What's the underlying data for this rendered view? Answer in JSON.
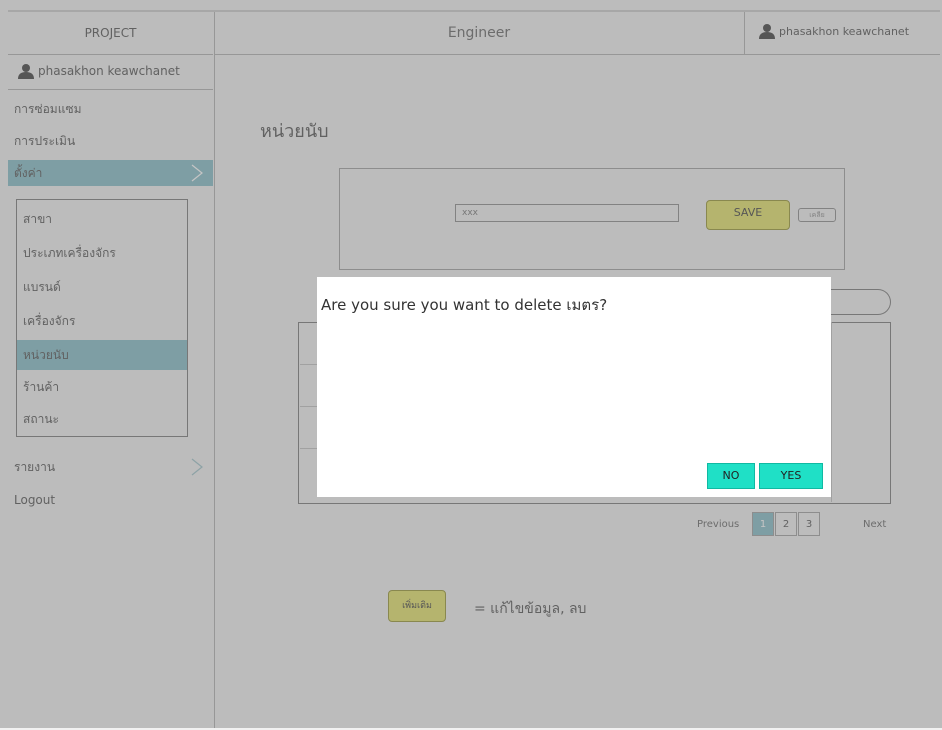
{
  "colors": {
    "accent": "#93c3cc",
    "button_yellow": "#e6e57a",
    "dialog_button": "#1fe0c6"
  },
  "sidebar": {
    "project_label": "PROJECT",
    "user_name": "phasakhon keawchanet",
    "menu": [
      {
        "label": "การซ่อมแซม"
      },
      {
        "label": "การประเมิน"
      },
      {
        "label": "ตั้งค่า"
      }
    ],
    "submenu": [
      {
        "label": "สาขา"
      },
      {
        "label": "ประเภทเครื่องจักร"
      },
      {
        "label": "แบรนด์"
      },
      {
        "label": "เครื่องจักร"
      },
      {
        "label": "หน่วยนับ"
      },
      {
        "label": "ร้านค้า"
      },
      {
        "label": "สถานะ"
      }
    ],
    "report_label": "รายงาน",
    "logout_label": "Logout"
  },
  "header": {
    "title": "Engineer",
    "user_name": "phasakhon keawchanet"
  },
  "main": {
    "page_title": "หน่วยนับ",
    "unit_input_value": "xxx",
    "save_label": "SAVE",
    "cancel_label": "เคลีย",
    "pager": {
      "previous": "Previous",
      "pages": [
        "1",
        "2",
        "3"
      ],
      "next": "Next"
    },
    "add_label": "เพิ่มเติม",
    "legend_text": "= แก้ไขข้อมูล, ลบ"
  },
  "dialog": {
    "message": "Are you sure you want to delete เมตร?",
    "no_label": "NO",
    "yes_label": "YES"
  }
}
